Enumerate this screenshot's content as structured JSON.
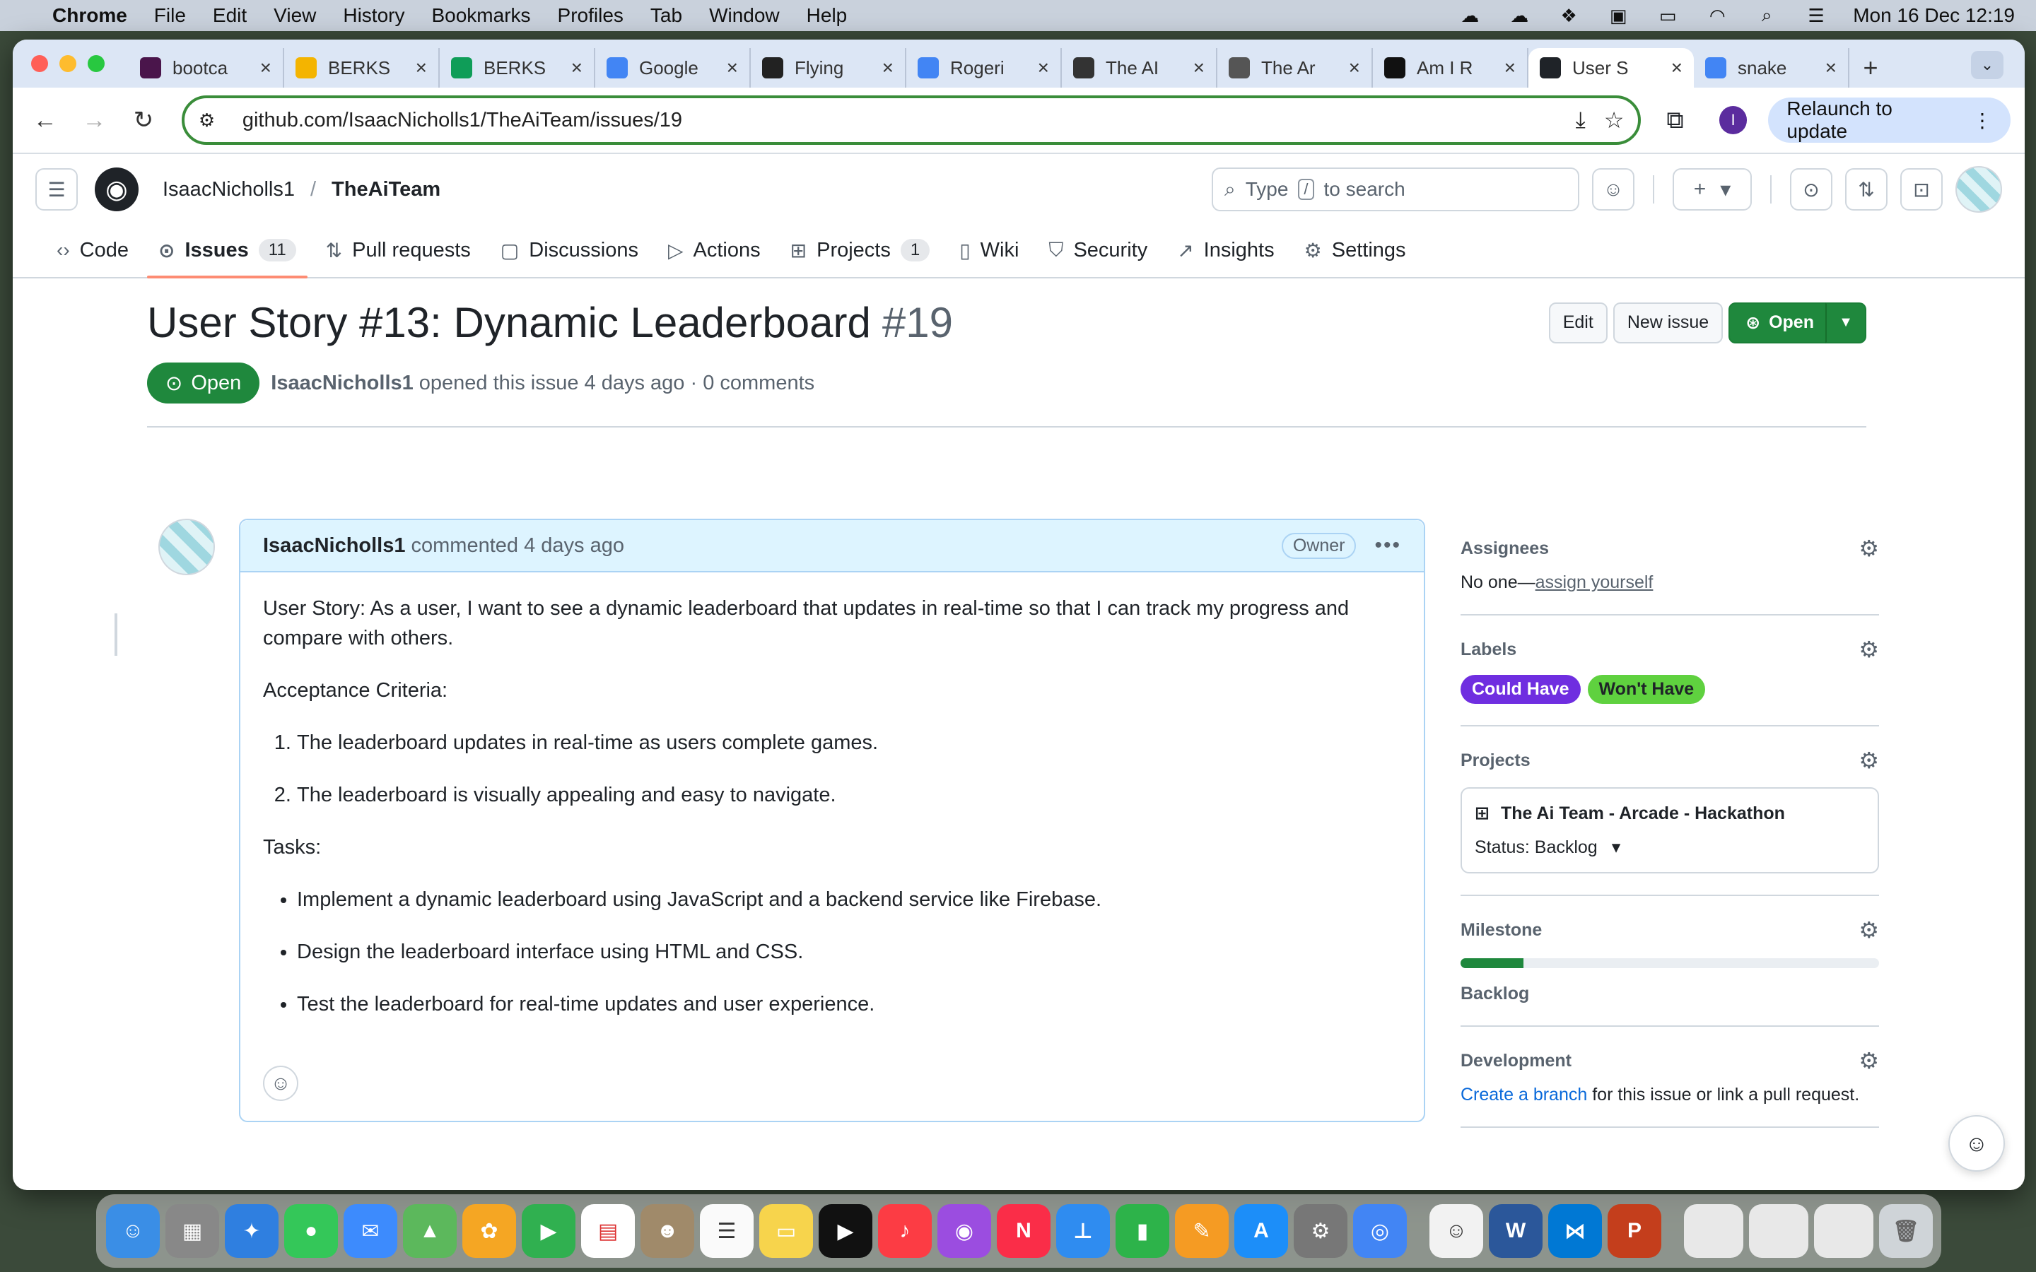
{
  "menubar": {
    "app": "Chrome",
    "items": [
      "File",
      "Edit",
      "View",
      "History",
      "Bookmarks",
      "Profiles",
      "Tab",
      "Window",
      "Help"
    ],
    "clock": "Mon 16 Dec  12:19"
  },
  "tabs": [
    {
      "label": "bootca",
      "color": "#4a154b",
      "icon": "slack-icon"
    },
    {
      "label": "BERKS",
      "color": "#f4b400",
      "icon": "slides-icon"
    },
    {
      "label": "BERKS",
      "color": "#0f9d58",
      "icon": "sheets-icon"
    },
    {
      "label": "Google",
      "color": "#4285f4",
      "icon": "calendar-icon"
    },
    {
      "label": "Flying",
      "color": "#222222",
      "icon": "codepen-icon"
    },
    {
      "label": "Rogeri",
      "color": "#4285f4",
      "icon": "chat-icon"
    },
    {
      "label": "The AI",
      "color": "#333333",
      "icon": "trello-icon"
    },
    {
      "label": "The Ar",
      "color": "#555555",
      "icon": "globe-icon"
    },
    {
      "label": "Am I R",
      "color": "#111111",
      "icon": "profile-icon"
    },
    {
      "label": "User S",
      "color": "#1f2328",
      "icon": "github-icon",
      "active": true
    },
    {
      "label": "snake",
      "color": "#4285f4",
      "icon": "google-icon"
    }
  ],
  "toolbar": {
    "url": "github.com/IsaacNicholls1/TheAiTeam/issues/19",
    "profile_initial": "I",
    "relaunch": "Relaunch to update"
  },
  "repo": {
    "owner": "IsaacNicholls1",
    "separator": "/",
    "name": "TheAiTeam",
    "search_placeholder_pre": "Type",
    "search_key": "/",
    "search_placeholder_post": "to search"
  },
  "nav": [
    {
      "label": "Code",
      "icon": "code-icon"
    },
    {
      "label": "Issues",
      "icon": "issue-icon",
      "count": "11",
      "active": true
    },
    {
      "label": "Pull requests",
      "icon": "pull-request-icon"
    },
    {
      "label": "Discussions",
      "icon": "discussion-icon"
    },
    {
      "label": "Actions",
      "icon": "play-icon"
    },
    {
      "label": "Projects",
      "icon": "table-icon",
      "count": "1"
    },
    {
      "label": "Wiki",
      "icon": "book-icon"
    },
    {
      "label": "Security",
      "icon": "shield-icon"
    },
    {
      "label": "Insights",
      "icon": "graph-icon"
    },
    {
      "label": "Settings",
      "icon": "gear-icon"
    }
  ],
  "issue": {
    "title": "User Story #13: Dynamic Leaderboard",
    "number": "#19",
    "edit": "Edit",
    "new_issue": "New issue",
    "open_button": "Open",
    "state": "Open",
    "author": "IsaacNicholls1",
    "opened_text": "opened this issue 4 days ago · 0 comments"
  },
  "comment": {
    "author": "IsaacNicholls1",
    "meta": "commented 4 days ago",
    "badge": "Owner",
    "story": "User Story: As a user, I want to see a dynamic leaderboard that updates in real-time so that I can track my progress and compare with others.",
    "criteria_heading": "Acceptance Criteria:",
    "criteria": [
      "The leaderboard updates in real-time as users complete games.",
      "The leaderboard is visually appealing and easy to navigate."
    ],
    "tasks_heading": "Tasks:",
    "tasks": [
      "Implement a dynamic leaderboard using JavaScript and a backend service like Firebase.",
      "Design the leaderboard interface using HTML and CSS.",
      "Test the leaderboard for real-time updates and user experience."
    ]
  },
  "sidebar": {
    "assignees": {
      "heading": "Assignees",
      "text": "No one—",
      "link": "assign yourself"
    },
    "labels": {
      "heading": "Labels",
      "items": [
        {
          "name": "Could Have",
          "bg": "#6f2ee0",
          "fg": "#ffffff"
        },
        {
          "name": "Won't Have",
          "bg": "#5fd13f",
          "fg": "#1f2328"
        }
      ]
    },
    "projects": {
      "heading": "Projects",
      "name": "The Ai Team - Arcade - Hackathon",
      "status": "Status: Backlog"
    },
    "milestone": {
      "heading": "Milestone",
      "progress": 0.15,
      "name": "Backlog"
    },
    "development": {
      "heading": "Development",
      "link": "Create a branch",
      "text": " for this issue or link a pull request."
    }
  },
  "colors": {
    "accent_green": "#1f883d",
    "link_blue": "#0969da",
    "tab_underline": "#fd8c73"
  }
}
